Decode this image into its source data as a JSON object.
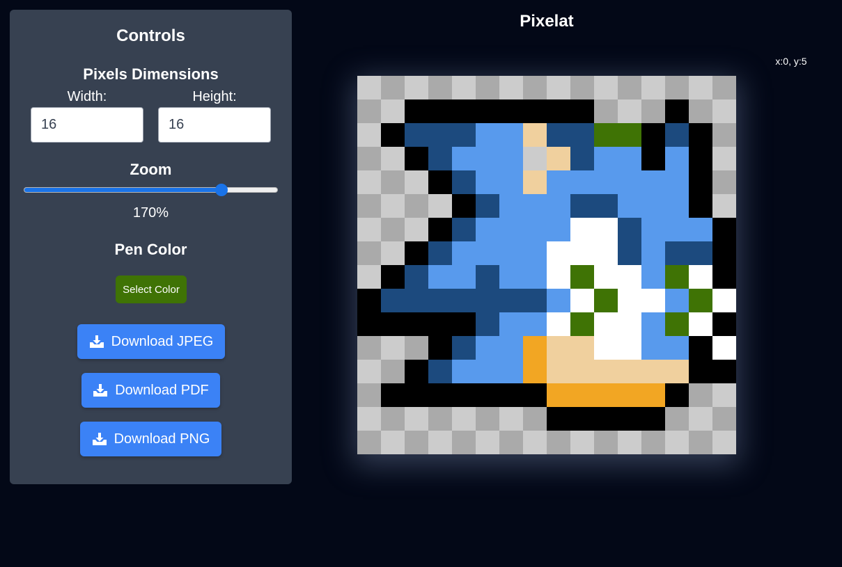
{
  "controls": {
    "title": "Controls",
    "pixel_dimensions_heading": "Pixels Dimensions",
    "width_label": "Width:",
    "height_label": "Height:",
    "width_value": "16",
    "height_value": "16",
    "zoom_heading": "Zoom",
    "zoom_value": "170%",
    "zoom_level": 0.78,
    "pen_color_heading": "Pen Color",
    "select_color_label": "Select Color",
    "pen_color": "#3f7305",
    "download_jpeg_label": "Download JPEG",
    "download_pdf_label": "Download PDF",
    "download_png_label": "Download PNG",
    "download_icon": "download-tray-icon"
  },
  "app": {
    "title": "Pixelat",
    "cursor_position": "x:0, y:5"
  },
  "canvas": {
    "cols": 16,
    "rows": 16,
    "palette": {
      "L": "#cccccc",
      "D": "#aaaaaa",
      "K": "#000000",
      "N": "#1c4a7e",
      "B": "#589aed",
      "C": "#f0d09e",
      "G": "#3f7305",
      "W": "#ffffff",
      "O": "#f2a623"
    },
    "pixels": [
      "LDLDLDLDLDLDLDLD",
      "DLKKKKKKKKDLDKDL",
      "LKNNNBBCNNGGKNKD",
      "DLKNBBBLCNBBKBKL",
      "LDLKNBBCBBBBBBKD",
      "DLDLKNBBBNNBBBKL",
      "LDLKNBBBBWWNBBBK",
      "DLKNBBBBWWWNBNNK",
      "LKNBBNBBWGWWBGWK",
      "KNNNNNNNBWGWWBGWK",
      "KKKKKNBBWGWWBGWK",
      "DLDKNBBOCCWWBBKW",
      "LDKNBBBOCCCCCCKK",
      "DKKKKKKKOOOOOKDL",
      "LDLDLDLDKKKKKDLD",
      "DLDLDLDLDLDLDLDL"
    ]
  }
}
